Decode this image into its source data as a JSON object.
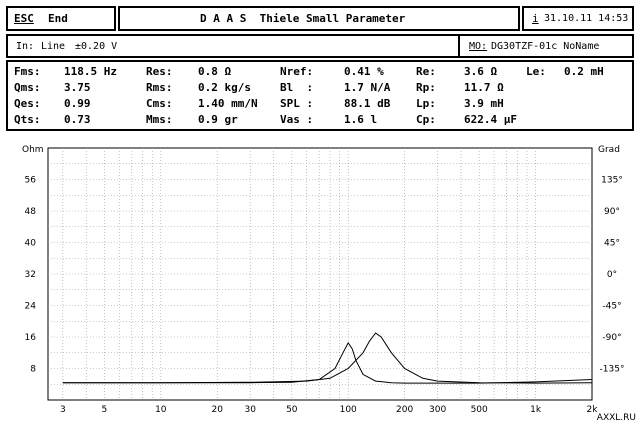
{
  "header": {
    "esc_key": "ESC",
    "esc_action": "End",
    "title": "D A A S  Thiele Small Parameter",
    "info_icon_glyph": "i",
    "datetime": "31.10.11 14:53"
  },
  "input_bar": {
    "prefix": "In:",
    "source": "Line",
    "level": "±0.20 V",
    "model_label": "MO:",
    "model_value": "DG30TZF-01c NoName"
  },
  "params": {
    "rows": [
      [
        {
          "label": "Fms:",
          "value": "118.5 Hz"
        },
        {
          "label": "Res:",
          "value": "0.8 Ω"
        },
        {
          "label": "Nref:",
          "value": "0.41 %"
        },
        {
          "label": "Re:",
          "value": "3.6 Ω"
        },
        {
          "label": "Le:",
          "value": "0.2 mH"
        }
      ],
      [
        {
          "label": "Qms:",
          "value": "3.75"
        },
        {
          "label": "Rms:",
          "value": "0.2 kg/s"
        },
        {
          "label": "Bl  :",
          "value": "1.7 N/A"
        },
        {
          "label": "Rp:",
          "value": "11.7 Ω"
        }
      ],
      [
        {
          "label": "Qes:",
          "value": "0.99"
        },
        {
          "label": "Cms:",
          "value": "1.40 mm/N"
        },
        {
          "label": "SPL :",
          "value": "88.1 dB"
        },
        {
          "label": "Lp:",
          "value": "3.9 mH"
        }
      ],
      [
        {
          "label": "Qts:",
          "value": "0.73"
        },
        {
          "label": "Mms:",
          "value": "0.9 gr"
        },
        {
          "label": "Vas :",
          "value": "1.6 l"
        },
        {
          "label": "Cp:",
          "value": "622.4 µF"
        }
      ]
    ]
  },
  "chart_data": {
    "type": "line",
    "x_scale": "log",
    "xlim": [
      2.5,
      2000
    ],
    "ylim": [
      0,
      64
    ],
    "y2lim": [
      -180,
      180
    ],
    "grid": true,
    "ylabel": "Ohm",
    "y2label": "Grad",
    "x_ticks": [
      {
        "v": 3,
        "label": "3"
      },
      {
        "v": 5,
        "label": "5"
      },
      {
        "v": 10,
        "label": "10"
      },
      {
        "v": 20,
        "label": "20"
      },
      {
        "v": 30,
        "label": "30"
      },
      {
        "v": 50,
        "label": "50"
      },
      {
        "v": 100,
        "label": "100"
      },
      {
        "v": 200,
        "label": "200"
      },
      {
        "v": 300,
        "label": "300"
      },
      {
        "v": 500,
        "label": "500"
      },
      {
        "v": 1000,
        "label": "1k"
      },
      {
        "v": 2000,
        "label": "2k"
      }
    ],
    "y_ticks": [
      {
        "v": 56,
        "label": "56"
      },
      {
        "v": 48,
        "label": "48"
      },
      {
        "v": 40,
        "label": "40"
      },
      {
        "v": 32,
        "label": "32"
      },
      {
        "v": 24,
        "label": "24"
      },
      {
        "v": 16,
        "label": "16"
      },
      {
        "v": 8,
        "label": "8"
      }
    ],
    "y2_ticks": [
      {
        "v": 135,
        "label": "135°"
      },
      {
        "v": 90,
        "label": "90°"
      },
      {
        "v": 45,
        "label": "45°"
      },
      {
        "v": 0,
        "label": "0°"
      },
      {
        "v": -45,
        "label": "-45°"
      },
      {
        "v": -90,
        "label": "-90°"
      },
      {
        "v": -135,
        "label": "-135°"
      }
    ],
    "series": [
      {
        "x": [
          3,
          10,
          30,
          50,
          70,
          85,
          95,
          100,
          105,
          110,
          120,
          140,
          170,
          200,
          300,
          500,
          1000,
          2000
        ],
        "y": [
          4.4,
          4.4,
          4.4,
          4.5,
          5.2,
          8,
          12.5,
          14.5,
          13,
          10,
          6.5,
          4.8,
          4.4,
          4.3,
          4.3,
          4.3,
          4.6,
          5.2
        ]
      },
      {
        "x": [
          3,
          10,
          30,
          60,
          80,
          100,
          120,
          130,
          140,
          150,
          170,
          200,
          250,
          300,
          500,
          1000,
          2000
        ],
        "y": [
          4.4,
          4.4,
          4.5,
          4.8,
          5.5,
          8,
          12,
          15,
          17,
          16,
          12,
          8,
          5.5,
          4.8,
          4.4,
          4.3,
          4.4
        ]
      }
    ]
  },
  "watermark": "AXXL.RU"
}
